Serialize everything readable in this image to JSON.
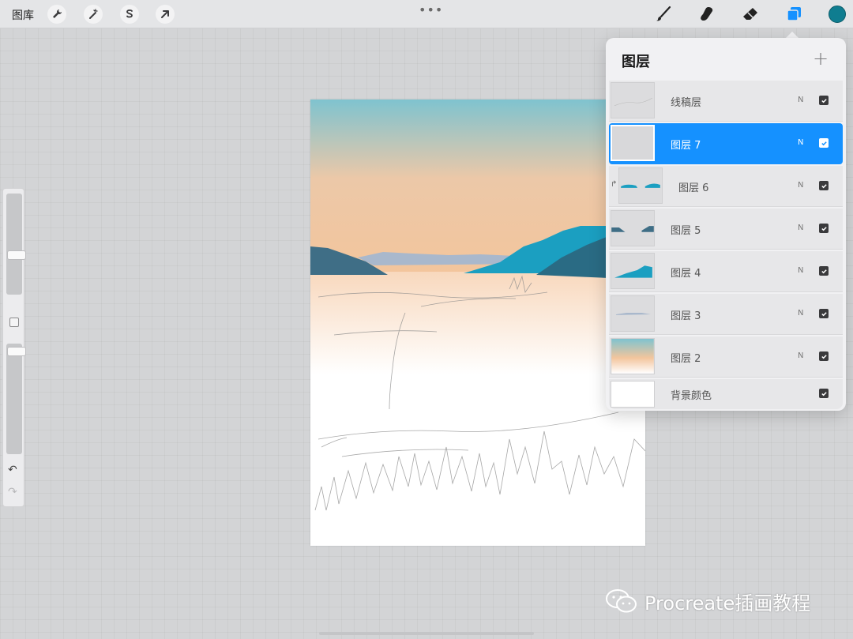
{
  "toolbar": {
    "gallery_label": "图库",
    "more_indicator": "•••",
    "actions_icon": "wrench-icon",
    "adjustments_icon": "magic-wand-icon",
    "selection_icon": "selection-s-icon",
    "transform_icon": "arrow-cursor-icon",
    "brush_icon": "brush-icon",
    "smudge_icon": "smudge-icon",
    "eraser_icon": "eraser-icon",
    "layers_icon": "layers-icon",
    "current_color": "#0f7d90",
    "active_tool_color": "#1591ff"
  },
  "sidebar": {
    "brush_size_level": 0.25,
    "opacity_level": 0.03,
    "undo_glyph": "↶",
    "redo_glyph": "↷"
  },
  "layers": {
    "title": "图层",
    "add_glyph": "+",
    "items": [
      {
        "name": "线稿层",
        "blend": "N",
        "visible": true,
        "selected": false
      },
      {
        "name": "图层 7",
        "blend": "N",
        "visible": true,
        "selected": true
      },
      {
        "name": "图层 6",
        "blend": "N",
        "visible": true,
        "selected": false,
        "clipped": true
      },
      {
        "name": "图层 5",
        "blend": "N",
        "visible": true,
        "selected": false
      },
      {
        "name": "图层 4",
        "blend": "N",
        "visible": true,
        "selected": false
      },
      {
        "name": "图层 3",
        "blend": "N",
        "visible": true,
        "selected": false
      },
      {
        "name": "图层 2",
        "blend": "N",
        "visible": true,
        "selected": false
      },
      {
        "name": "背景颜色",
        "blend": "",
        "visible": true,
        "selected": false
      }
    ]
  },
  "watermark": {
    "text": "Procreate插画教程",
    "icon": "wechat-icon"
  },
  "colors": {
    "sky_top": "#7fc3cf",
    "sky_bottom": "#f3c59c",
    "mountain_teal": "#1b9fc1",
    "mountain_dark": "#2a6b84",
    "selection_blue": "#1591ff"
  }
}
